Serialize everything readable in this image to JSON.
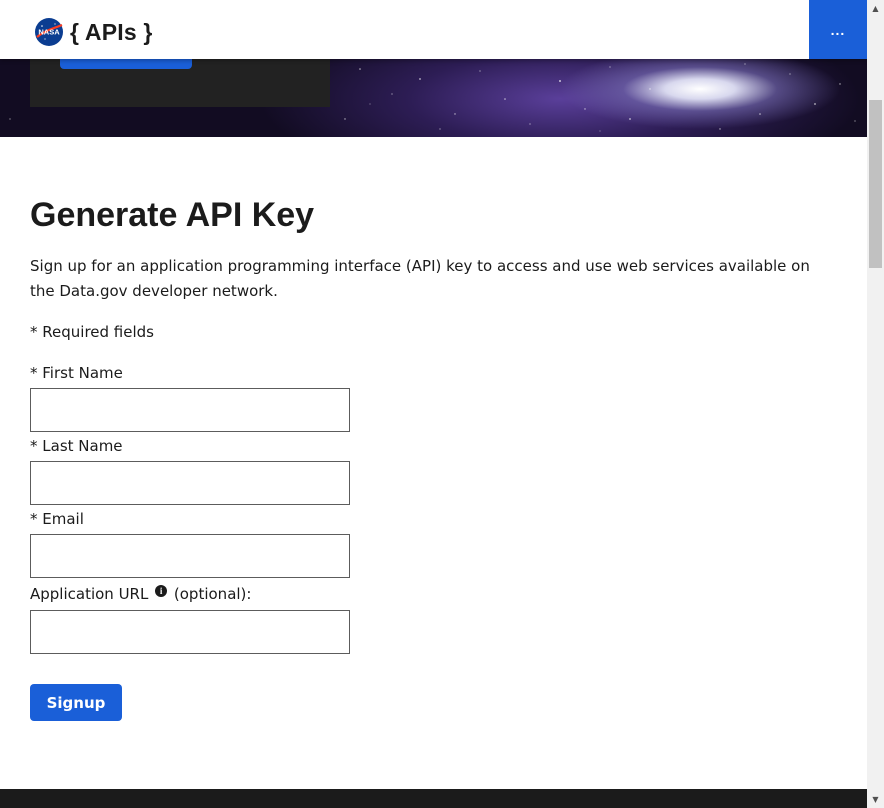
{
  "header": {
    "logo_icon": "nasa-meatball-logo",
    "brand": "{ APIs }",
    "menu_label": "...",
    "accent_color": "#1a5fd8"
  },
  "main": {
    "title": "Generate API Key",
    "intro": "Sign up for an application programming interface (API) key to access and use web services available on the Data.gov developer network.",
    "required_note": "* Required fields",
    "fields": [
      {
        "label": "* First Name",
        "value": ""
      },
      {
        "label": "* Last Name",
        "value": ""
      },
      {
        "label": "* Email",
        "value": ""
      },
      {
        "label_before": "Application URL",
        "label_after": "(optional):",
        "info_icon": "info-icon",
        "value": ""
      }
    ],
    "submit_label": "Signup"
  },
  "scrollbar": {
    "up_glyph": "▲",
    "down_glyph": "▼"
  }
}
